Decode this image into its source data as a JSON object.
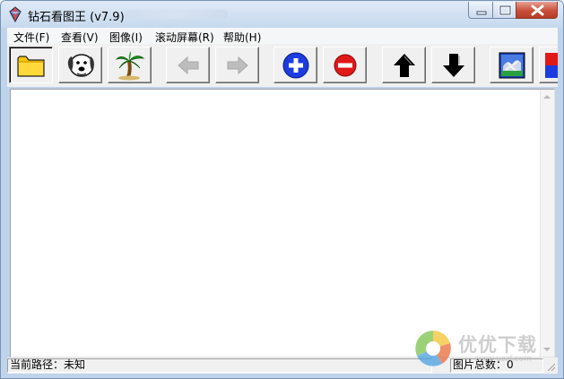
{
  "window": {
    "title": "钻石看图王 (v7.9)"
  },
  "menu": {
    "items": [
      "文件(F)",
      "查看(V)",
      "图像(I)",
      "滚动屏幕(R)",
      "帮助(H)"
    ]
  },
  "toolbar": {
    "buttons": [
      {
        "icon": "folder-icon"
      },
      {
        "icon": "dog-icon"
      },
      {
        "icon": "palm-tree-icon"
      },
      {
        "icon": "arrow-left-icon",
        "disabled": true
      },
      {
        "icon": "arrow-right-icon",
        "disabled": true
      },
      {
        "icon": "zoom-in-icon"
      },
      {
        "icon": "zoom-out-icon"
      },
      {
        "icon": "arrow-up-icon"
      },
      {
        "icon": "arrow-down-icon"
      },
      {
        "icon": "image-preview-icon"
      },
      {
        "icon": "color-icon"
      }
    ]
  },
  "status": {
    "path": "当前路径：未知",
    "count": "图片总数：0"
  },
  "watermark": {
    "text": "优优下载",
    "url": "www.uzzf.com"
  },
  "colors": {
    "titlebar": "#c6d9ee",
    "close_button": "#c8503a",
    "toolbar_bg": "#f0f0f0",
    "zoom_in_blue": "#1c3ce0",
    "zoom_out_red": "#e01818"
  }
}
